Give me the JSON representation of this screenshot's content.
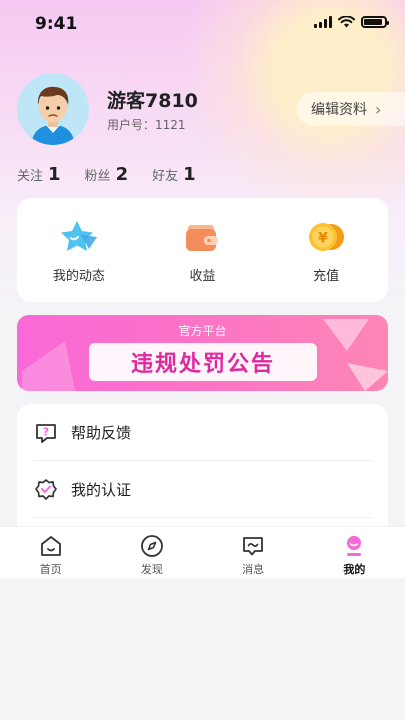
{
  "status_bar": {
    "time": "9:41"
  },
  "profile": {
    "username": "游客7810",
    "user_id_label": "用户号：1121",
    "edit_label": "编辑资料"
  },
  "stats": [
    {
      "label": "关注",
      "value": "1"
    },
    {
      "label": "粉丝",
      "value": "2"
    },
    {
      "label": "好友",
      "value": "1"
    }
  ],
  "actions": [
    {
      "label": "我的动态",
      "icon": "star-icon"
    },
    {
      "label": "收益",
      "icon": "wallet-icon"
    },
    {
      "label": "充值",
      "icon": "coin-icon"
    }
  ],
  "banner": {
    "subtitle": "官方平台",
    "title": "违规处罚公告"
  },
  "menu": [
    {
      "label": "帮助反馈",
      "icon": "help-chat-icon"
    },
    {
      "label": "我的认证",
      "icon": "verified-badge-icon"
    }
  ],
  "tabbar": [
    {
      "label": "首页",
      "icon": "home-icon",
      "active": false
    },
    {
      "label": "发现",
      "icon": "compass-icon",
      "active": false
    },
    {
      "label": "消息",
      "icon": "message-icon",
      "active": false
    },
    {
      "label": "我的",
      "icon": "profile-icon",
      "active": true
    }
  ],
  "colors": {
    "accent": "#f969d8",
    "banner_text": "#e0289f",
    "active_tab": "#f56bd6"
  }
}
